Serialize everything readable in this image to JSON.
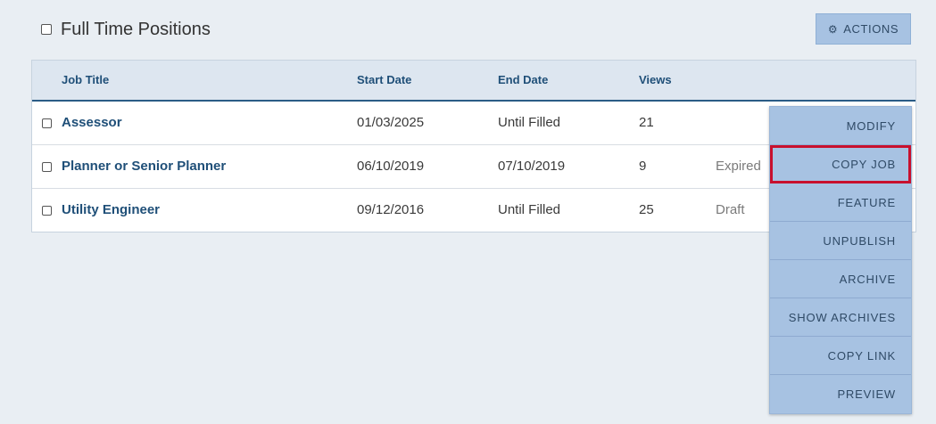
{
  "header": {
    "title": "Full Time Positions",
    "actions_label": "ACTIONS"
  },
  "table": {
    "columns": {
      "job_title": "Job Title",
      "start_date": "Start Date",
      "end_date": "End Date",
      "views": "Views"
    },
    "rows": [
      {
        "title": "Assessor",
        "start": "01/03/2025",
        "end": "Until Filled",
        "views": "21",
        "status": ""
      },
      {
        "title": "Planner or Senior Planner",
        "start": "06/10/2019",
        "end": "07/10/2019",
        "views": "9",
        "status": "Expired"
      },
      {
        "title": "Utility Engineer",
        "start": "09/12/2016",
        "end": "Until Filled",
        "views": "25",
        "status": "Draft"
      }
    ]
  },
  "menu": {
    "items": [
      "MODIFY",
      "COPY JOB",
      "FEATURE",
      "UNPUBLISH",
      "ARCHIVE",
      "SHOW ARCHIVES",
      "COPY LINK",
      "PREVIEW"
    ],
    "highlighted": "COPY JOB"
  },
  "colors": {
    "accent": "#1f4f78",
    "menu_bg": "#a7c2e2",
    "highlight": "#c8102e"
  }
}
